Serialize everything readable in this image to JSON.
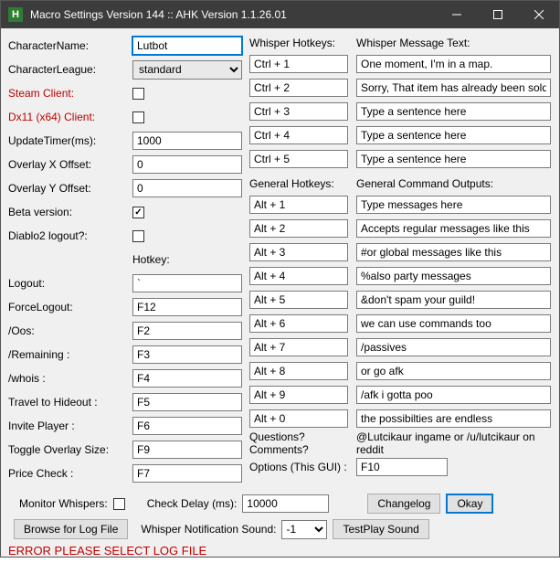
{
  "window": {
    "title": "Macro Settings Version 144 :: AHK Version 1.1.26.01",
    "icon_letter": "H"
  },
  "left": {
    "character_name": {
      "label": "CharacterName:",
      "value": "Lutbot"
    },
    "character_league": {
      "label": "CharacterLeague:",
      "value": "standard"
    },
    "steam_client": {
      "label": "Steam Client:",
      "checked": false
    },
    "dx11_client": {
      "label": "Dx11 (x64) Client:",
      "checked": false
    },
    "update_timer": {
      "label": "UpdateTimer(ms):",
      "value": "1000"
    },
    "overlay_x": {
      "label": "Overlay X Offset:",
      "value": "0"
    },
    "overlay_y": {
      "label": "Overlay Y Offset:",
      "value": "0"
    },
    "beta_version": {
      "label": "Beta version:",
      "checked": true
    },
    "diablo2_logout": {
      "label": "Diablo2 logout?:",
      "checked": false
    },
    "hotkey_header": "Hotkey:",
    "logout": {
      "label": "Logout:",
      "value": "`"
    },
    "force_logout": {
      "label": "ForceLogout:",
      "value": "F12"
    },
    "oos": {
      "label": "/Oos:",
      "value": "F2"
    },
    "remaining": {
      "label": "/Remaining :",
      "value": "F3"
    },
    "whois": {
      "label": "/whois :",
      "value": "F4"
    },
    "travel_hideout": {
      "label": "Travel to Hideout :",
      "value": "F5"
    },
    "invite_player": {
      "label": "Invite Player :",
      "value": "F6"
    },
    "toggle_overlay": {
      "label": "Toggle Overlay Size:",
      "value": "F9"
    },
    "price_check": {
      "label": "Price Check :",
      "value": "F7"
    }
  },
  "whisper": {
    "hotkeys_label": "Whisper Hotkeys:",
    "message_label": "Whisper Message Text:",
    "rows": [
      {
        "hk": "Ctrl + 1",
        "msg": "One moment, I'm in a map."
      },
      {
        "hk": "Ctrl + 2",
        "msg": "Sorry, That item has already been sold."
      },
      {
        "hk": "Ctrl + 3",
        "msg": "Type a sentence here"
      },
      {
        "hk": "Ctrl + 4",
        "msg": "Type a sentence here"
      },
      {
        "hk": "Ctrl + 5",
        "msg": "Type a sentence here"
      }
    ]
  },
  "general": {
    "hotkeys_label": "General Hotkeys:",
    "outputs_label": "General Command Outputs:",
    "rows": [
      {
        "hk": "Alt + 1",
        "msg": "Type messages here"
      },
      {
        "hk": "Alt + 2",
        "msg": "Accepts regular messages like this"
      },
      {
        "hk": "Alt + 3",
        "msg": "#or global messages like this"
      },
      {
        "hk": "Alt + 4",
        "msg": "%also party messages"
      },
      {
        "hk": "Alt + 5",
        "msg": "&don't spam your guild!"
      },
      {
        "hk": "Alt + 6",
        "msg": "we can use commands too"
      },
      {
        "hk": "Alt + 7",
        "msg": "/passives"
      },
      {
        "hk": "Alt + 8",
        "msg": "or go afk"
      },
      {
        "hk": "Alt + 9",
        "msg": "/afk i gotta poo"
      },
      {
        "hk": "Alt + 0",
        "msg": "the possibilties are endless"
      }
    ],
    "questions_label": "Questions? Comments?",
    "questions_value": "@Lutcikaur ingame or /u/lutcikaur on reddit"
  },
  "options": {
    "label": "Options (This GUI) :",
    "value": "F10"
  },
  "bottom": {
    "monitor_whispers_label": "Monitor Whispers:",
    "monitor_whispers_checked": false,
    "check_delay_label": "Check Delay (ms):",
    "check_delay_value": "10000",
    "changelog_btn": "Changelog",
    "okay_btn": "Okay",
    "browse_btn": "Browse for Log File",
    "whisper_sound_label": "Whisper Notification Sound:",
    "whisper_sound_value": "-1",
    "testplay_btn": "TestPlay Sound",
    "error": "ERROR PLEASE SELECT LOG FILE"
  }
}
